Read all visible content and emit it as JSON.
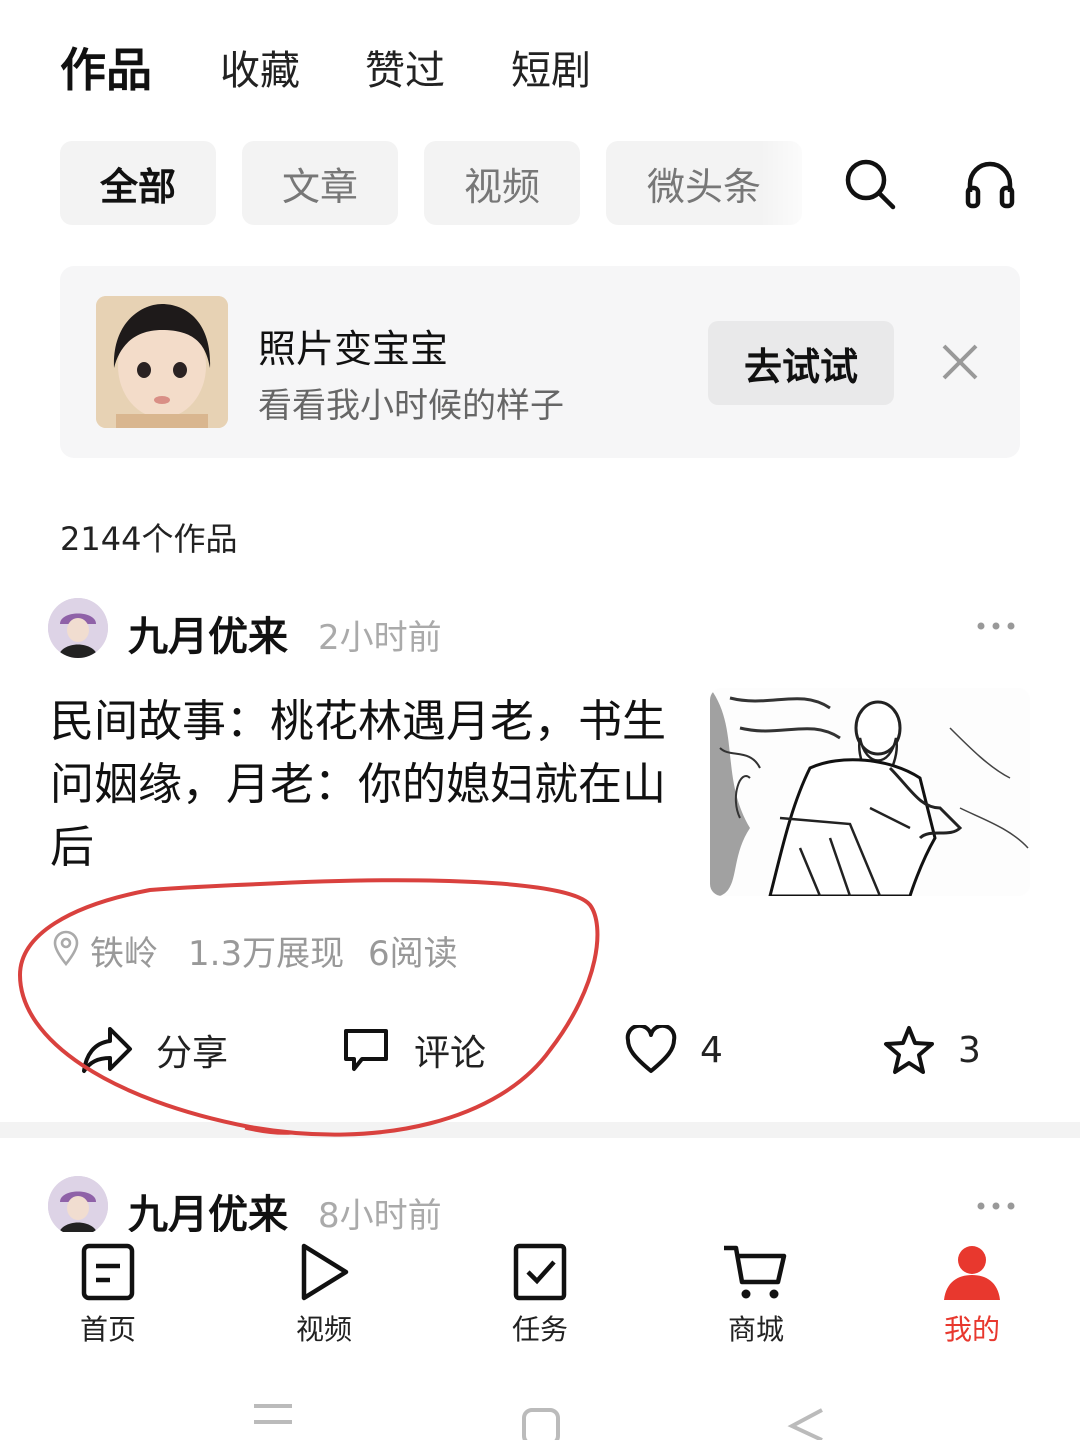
{
  "top_tabs": [
    "作品",
    "收藏",
    "赞过",
    "短剧"
  ],
  "filter_chips": [
    "全部",
    "文章",
    "视频",
    "微头条"
  ],
  "promo": {
    "title": "照片变宝宝",
    "subtitle": "看看我小时候的样子",
    "button": "去试试"
  },
  "works_count": "2144个作品",
  "posts": [
    {
      "author": "九月优来",
      "time": "2小时前",
      "title": "民间故事：桃花林遇月老，书生问姻缘，月老：你的媳妇就在山后",
      "location": "铁岭",
      "impressions": "1.3万展现",
      "reads": "6阅读",
      "actions": {
        "share": "分享",
        "comment": "评论",
        "likes": "4",
        "favorites": "3"
      }
    },
    {
      "author": "九月优来",
      "time": "8小时前"
    }
  ],
  "bottom_nav": [
    {
      "label": "首页",
      "icon": "document-icon"
    },
    {
      "label": "视频",
      "icon": "play-icon"
    },
    {
      "label": "任务",
      "icon": "checkbox-icon"
    },
    {
      "label": "商城",
      "icon": "cart-icon"
    },
    {
      "label": "我的",
      "icon": "person-icon"
    }
  ],
  "colors": {
    "accent": "#e8382e",
    "annotation": "#d9413e",
    "muted": "#999999"
  }
}
